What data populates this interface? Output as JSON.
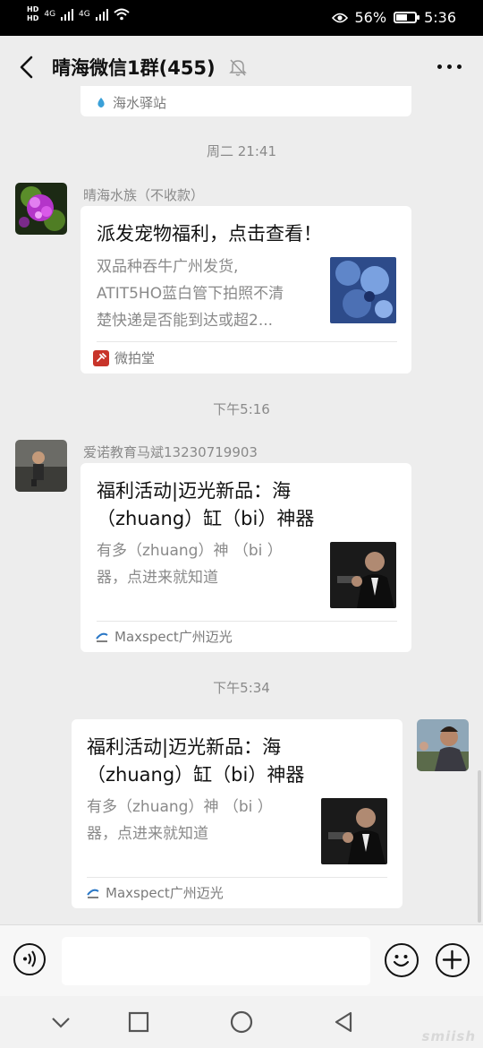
{
  "status_bar": {
    "hd1": "HD",
    "hd2": "HD",
    "net1": "4G",
    "net2": "4G",
    "battery_text": "56%",
    "battery_level": 0.56,
    "time": "5:36"
  },
  "header": {
    "title": "晴海微信1群(455)",
    "back_icon": "chevron-left-icon",
    "mute_icon": "bell-mute-icon",
    "more_icon": "more-horizontal-icon"
  },
  "messages": {
    "prev_source": "海水驿站",
    "ts1": "周二 21:41",
    "m1": {
      "sender": "晴海水族（不收款）",
      "title": "派发宠物福利，点击查看！",
      "desc1": "双品种吞牛广州发货,",
      "desc2": "ATIT5HO蓝白管下拍照不清",
      "desc3": "楚快递是否能到达或超2...",
      "source": "微拍堂",
      "source_icon": "gavel-icon"
    },
    "ts2": "下午5:16",
    "m2": {
      "sender": "爱诺教育马斌13230719903",
      "title1": "福利活动|迈光新品：海",
      "title2": "（zhuang）缸（bi）神器",
      "desc1": "有多（zhuang）神 （bi ）",
      "desc2": "器，点进来就知道",
      "source": "Maxspect广州迈光",
      "source_icon": "maxspect-logo-icon"
    },
    "ts3": "下午5:34",
    "m3": {
      "title1": "福利活动|迈光新品：海",
      "title2": "（zhuang）缸（bi）神器",
      "desc1": "有多（zhuang）神 （bi ）",
      "desc2": "器，点进来就知道",
      "source": "Maxspect广州迈光",
      "source_icon": "maxspect-logo-icon"
    }
  },
  "input_bar": {
    "voice_icon": "voice-icon",
    "emoji_icon": "emoji-icon",
    "plus_icon": "plus-icon"
  },
  "nav_bar": {
    "back": "triangle-back-icon",
    "home": "circle-home-icon",
    "recents": "square-recents-icon",
    "hide": "chevron-down-icon"
  },
  "watermark": "smiish",
  "colors": {
    "background": "#ededed",
    "bubble": "#ffffff",
    "meta_text": "#8a8a8a"
  }
}
